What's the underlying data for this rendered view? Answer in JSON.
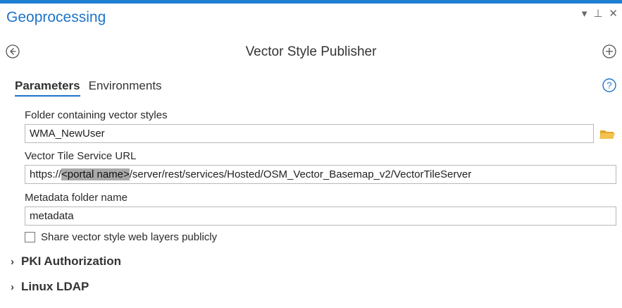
{
  "pane": {
    "title": "Geoprocessing",
    "controls": {
      "dropdown": "▾",
      "pin": "⊥",
      "close": "✕"
    }
  },
  "tool": {
    "name": "Vector Style Publisher"
  },
  "tabs": [
    {
      "label": "Parameters",
      "active": true
    },
    {
      "label": "Environments",
      "active": false
    }
  ],
  "parameters": {
    "folder": {
      "label": "Folder containing vector styles",
      "value": "WMA_NewUser"
    },
    "url": {
      "label": "Vector Tile Service URL",
      "value_prefix": "https://",
      "value_highlight": "<portal name>",
      "value_suffix": "/server/rest/services/Hosted/OSM_Vector_Basemap_v2/VectorTileServer"
    },
    "metadata": {
      "label": "Metadata folder name",
      "value": "metadata"
    },
    "share": {
      "label": "Share vector style web layers publicly",
      "checked": false
    }
  },
  "sections": [
    {
      "label": "PKI Authorization",
      "chevron": "›"
    },
    {
      "label": "Linux LDAP",
      "chevron": "›"
    }
  ],
  "colors": {
    "accent": "#1e74c8",
    "folder": "#f2c14e"
  }
}
